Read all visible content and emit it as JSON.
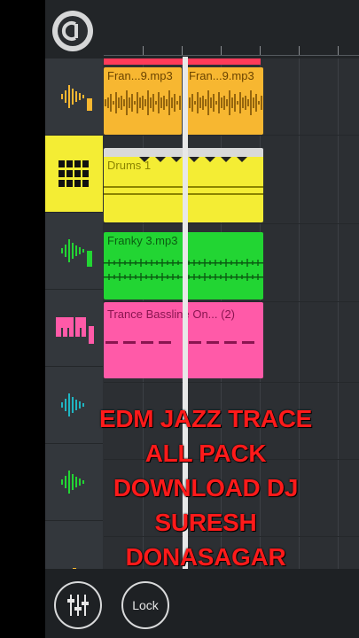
{
  "tracks": [
    {
      "clips": [
        {
          "title": "Fran...9.mp3"
        },
        {
          "title": "Fran...9.mp3"
        }
      ],
      "color": "#f7b731",
      "icon": "waveform-icon"
    },
    {
      "clips": [
        {
          "title": "Drums 1"
        }
      ],
      "color": "#f4ed34",
      "icon": "drum-pad-icon"
    },
    {
      "clips": [
        {
          "title": "Franky 3.mp3"
        }
      ],
      "color": "#22d533",
      "icon": "waveform-icon"
    },
    {
      "clips": [
        {
          "title": "Trance Bassline On...   (2)"
        }
      ],
      "color": "#ff5aa8",
      "icon": "piano-icon"
    },
    {
      "clips": [],
      "color": "#1fb5c2",
      "icon": "waveform-icon"
    },
    {
      "clips": [],
      "color": "#22d533",
      "icon": "waveform-icon"
    }
  ],
  "toolbar": {
    "lock_label": "Lock"
  },
  "overlay": {
    "lines": [
      "EDM JAZZ TRACE",
      "ALL PACK",
      "DOWNLOAD DJ",
      "SURESH",
      "DONASAGAR"
    ]
  },
  "colors": {
    "background": "#2c2f33",
    "loop": "#ff3b5a",
    "overlay_text": "#ff1a1a"
  }
}
